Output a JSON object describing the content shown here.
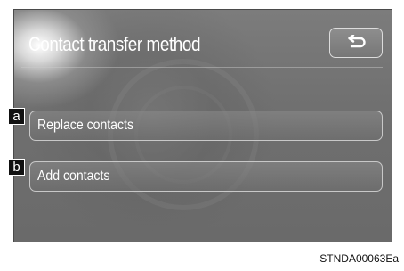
{
  "screen": {
    "title": "Contact transfer method",
    "back_button_icon": "return-arrow-icon",
    "options": [
      {
        "callout": "a",
        "label": "Replace contacts"
      },
      {
        "callout": "b",
        "label": "Add contacts"
      }
    ]
  },
  "figure": {
    "reference_code": "STNDA00063Ea"
  },
  "colors": {
    "screen_background": "#727272",
    "text": "#ffffff",
    "button_border": "#c8c8c8",
    "callout_background": "#111111"
  }
}
